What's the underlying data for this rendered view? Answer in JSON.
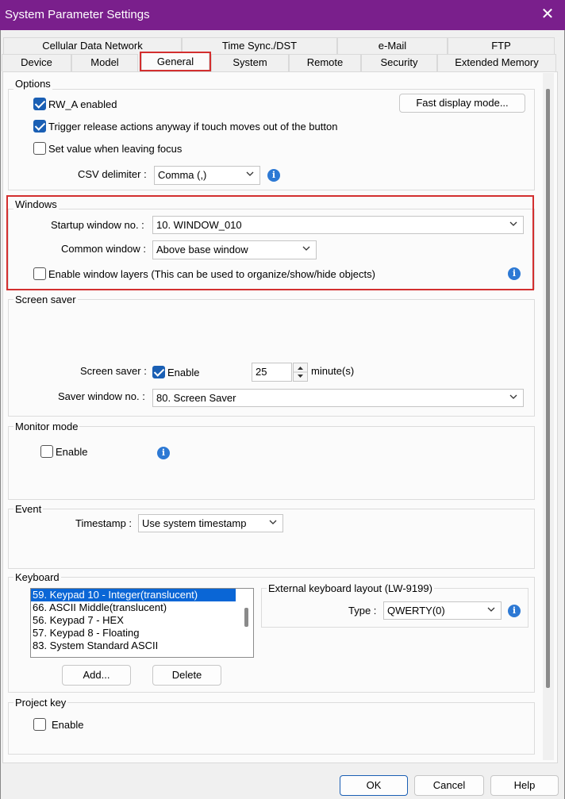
{
  "window": {
    "title": "System Parameter Settings",
    "close_glyph": "✕"
  },
  "tabs_row1": [
    "Cellular Data Network",
    "Time Sync./DST",
    "e-Mail",
    "FTP"
  ],
  "tabs_row2": [
    "Device",
    "Model",
    "General",
    "System",
    "Remote",
    "Security",
    "Extended Memory"
  ],
  "options": {
    "label": "Options",
    "rw_a": "RW_A enabled",
    "trigger": "Trigger release actions anyway if touch moves out of the button",
    "set_value": "Set value when leaving focus",
    "fast_display": "Fast display mode...",
    "csv_label": "CSV delimiter :",
    "csv_value": "Comma (,)"
  },
  "windows": {
    "label": "Windows",
    "startup_label": "Startup window no. :",
    "startup_value": "10. WINDOW_010",
    "common_label": "Common window :",
    "common_value": "Above base window",
    "layers": "Enable window layers (This can be used to organize/show/hide objects)"
  },
  "screen_saver": {
    "label": "Screen saver",
    "ss_label": "Screen saver :",
    "enable": "Enable",
    "minutes_value": "25",
    "minutes_unit": "minute(s)",
    "saver_window_label": "Saver window no. :",
    "saver_window_value": "80. Screen Saver"
  },
  "monitor": {
    "label": "Monitor mode",
    "enable": "Enable"
  },
  "event": {
    "label": "Event",
    "timestamp_label": "Timestamp :",
    "timestamp_value": "Use system timestamp"
  },
  "keyboard": {
    "label": "Keyboard",
    "items": [
      "59. Keypad 10 - Integer(translucent)",
      "66. ASCII Middle(translucent)",
      "56. Keypad 7 - HEX",
      "57. Keypad 8 - Floating",
      "83. System Standard ASCII"
    ],
    "add": "Add...",
    "delete": "Delete",
    "external_label": "External keyboard layout (LW-9199)",
    "type_label": "Type :",
    "type_value": "QWERTY(0)"
  },
  "project_key": {
    "label": "Project key",
    "enable": "Enable"
  },
  "footer": {
    "ok": "OK",
    "cancel": "Cancel",
    "help": "Help"
  },
  "colors": {
    "titlebar": "#7a1f8c",
    "accent": "#1a5fb4",
    "highlight": "#d32f2f",
    "info": "#2d79d4"
  },
  "icons": {
    "info": "info-icon",
    "chevron": "chevron-down-icon",
    "close": "close-icon"
  }
}
